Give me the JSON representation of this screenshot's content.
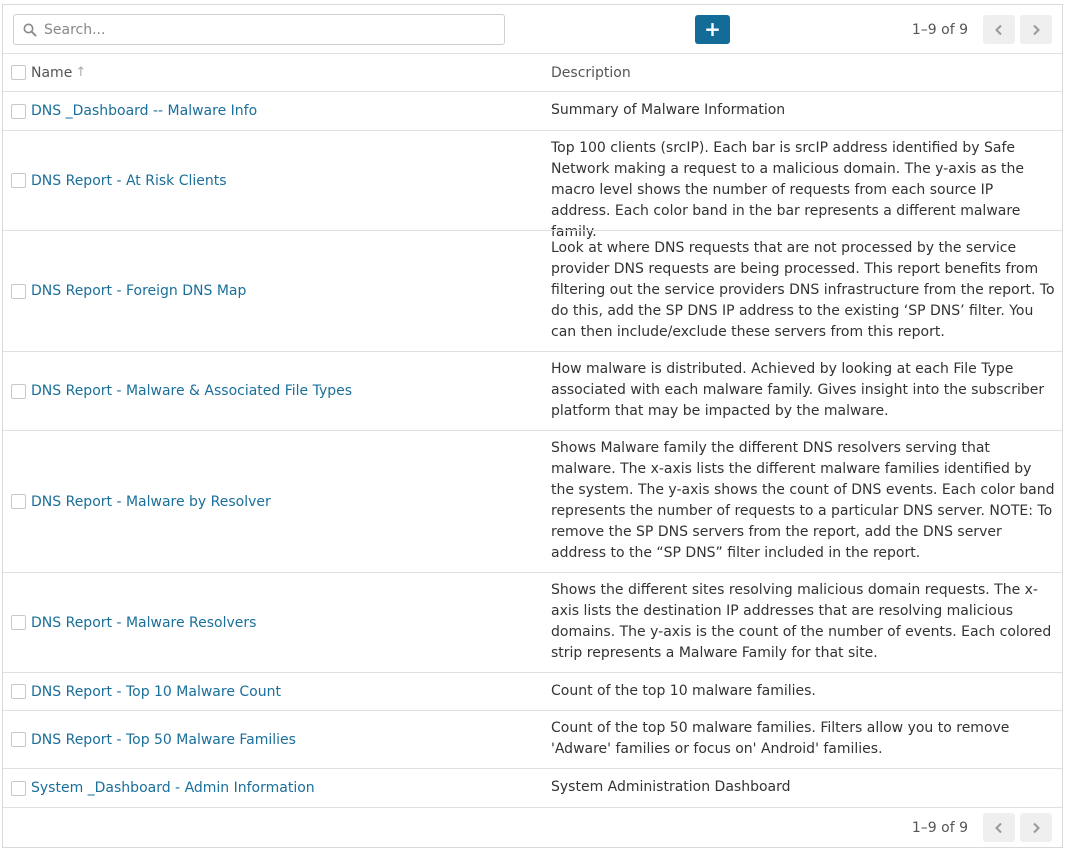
{
  "search": {
    "placeholder": "Search..."
  },
  "add_button": {
    "label": "+"
  },
  "pagination": {
    "range_text": "1–9 of 9"
  },
  "columns": {
    "name": "Name",
    "description": "Description"
  },
  "colors": {
    "link": "#1a6f9a",
    "primary_button": "#136c97"
  },
  "rows": [
    {
      "name": "DNS _Dashboard -- Malware Info",
      "description": "Summary of Malware Information"
    },
    {
      "name": "DNS Report - At Risk Clients",
      "description": "Top 100 clients (srcIP). Each bar is srcIP address identified by Safe Network making a request to a malicious domain. The y-axis as the macro level shows the number of requests from each source IP address. Each color band in the bar represents a different malware family."
    },
    {
      "name": "DNS Report - Foreign DNS Map",
      "description": "Look at where DNS requests that are not processed by the service provider DNS requests are being processed. This report benefits from filtering out the service providers DNS infrastructure from the report. To do this, add the SP DNS IP address to the existing ‘SP DNS’ filter. You can then include/exclude these servers from this report."
    },
    {
      "name": "DNS Report - Malware & Associated File Types",
      "description": "How malware is distributed. Achieved by looking at each File Type associated with each malware family. Gives insight into the subscriber platform that may be impacted by the malware."
    },
    {
      "name": "DNS Report - Malware by Resolver",
      "description": "Shows Malware family the different DNS resolvers serving that malware. The x-axis lists the different malware families identified by the system. The y-axis shows the count of DNS events. Each color band represents the number of requests to a particular DNS server. NOTE: To remove the SP DNS servers from the report, add the DNS server address to the “SP DNS” filter included in the report."
    },
    {
      "name": "DNS Report - Malware Resolvers",
      "description": "Shows the different sites resolving malicious domain requests. The x-axis lists the destination IP addresses that are resolving malicious domains. The y-axis is the count of the number of events. Each colored strip represents a Malware Family for that site."
    },
    {
      "name": "DNS Report - Top 10 Malware Count",
      "description": "Count of the top 10 malware families."
    },
    {
      "name": "DNS Report - Top 50 Malware Families",
      "description": "Count of the top 50 malware families. Filters allow you to remove 'Adware' families or focus on' Android' families."
    },
    {
      "name": "System _Dashboard - Admin Information",
      "description": "System Administration Dashboard"
    }
  ]
}
